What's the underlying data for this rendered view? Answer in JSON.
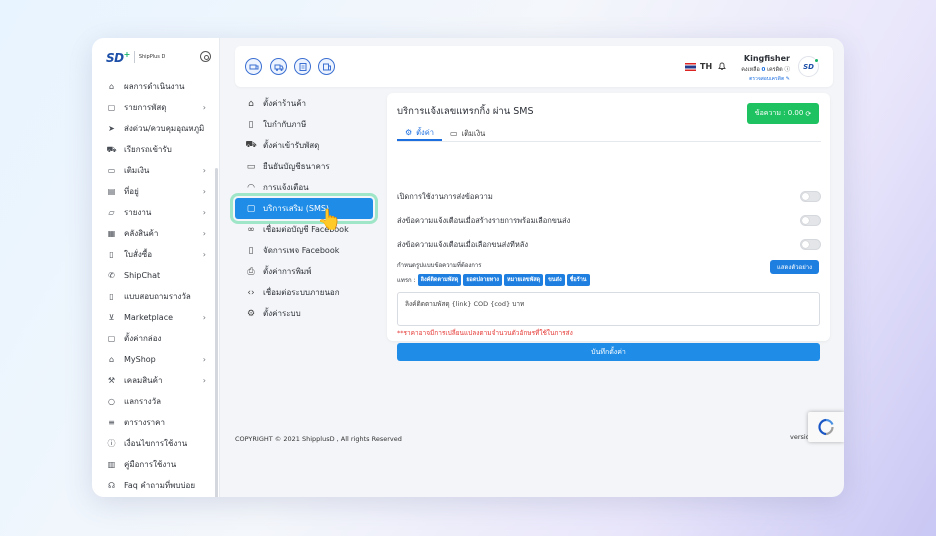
{
  "brand": {
    "logo": "SD",
    "logo_plus": "+",
    "sub": "ShipPlus D"
  },
  "sidebar": {
    "items": [
      {
        "label": "ผลการดำเนินงาน",
        "icon": "home-icon",
        "chevron": false
      },
      {
        "label": "รายการพัสดุ",
        "icon": "box-icon",
        "chevron": true
      },
      {
        "label": "ส่งด่วน/ควบคุมอุณหภูมิ",
        "icon": "fast-ship-icon",
        "chevron": false
      },
      {
        "label": "เรียกรถเข้ารับ",
        "icon": "truck-icon",
        "chevron": false
      },
      {
        "label": "เติมเงิน",
        "icon": "wallet-icon",
        "chevron": true
      },
      {
        "label": "ที่อยู่",
        "icon": "address-book-icon",
        "chevron": true
      },
      {
        "label": "รายงาน",
        "icon": "folder-icon",
        "chevron": true
      },
      {
        "label": "คลังสินค้า",
        "icon": "warehouse-icon",
        "chevron": true
      },
      {
        "label": "ใบสั่งซื้อ",
        "icon": "document-icon",
        "chevron": true
      },
      {
        "label": "ShipChat",
        "icon": "chat-icon",
        "chevron": false
      },
      {
        "label": "แบบสอบถามรางวัล",
        "icon": "document-icon",
        "chevron": false
      },
      {
        "label": "Marketplace",
        "icon": "cart-icon",
        "chevron": true
      },
      {
        "label": "ตั้งค่ากล่อง",
        "icon": "box-icon",
        "chevron": false
      },
      {
        "label": "MyShop",
        "icon": "shop-icon",
        "chevron": true
      },
      {
        "label": "เคลมสินค้า",
        "icon": "wrench-icon",
        "chevron": true
      },
      {
        "label": "แลกรางวัล",
        "icon": "reward-icon",
        "chevron": false
      },
      {
        "label": "ตารางราคา",
        "icon": "list-icon",
        "chevron": false
      },
      {
        "label": "เงื่อนไขการใช้งาน",
        "icon": "info-icon",
        "chevron": false
      },
      {
        "label": "คู่มือการใช้งาน",
        "icon": "book-icon",
        "chevron": false
      },
      {
        "label": "Faq คำถามที่พบบ่อย",
        "icon": "headset-icon",
        "chevron": false
      }
    ]
  },
  "header": {
    "lang": "TH",
    "user_name": "Kingfisher",
    "balance_label": "คงเหลือ",
    "balance_value": "0",
    "balance_unit": "เครดิต",
    "user_link": "ตรวจสอบเครดิต",
    "avatar_text": "SD"
  },
  "settings_menu": {
    "items": [
      {
        "label": "ตั้งค่าร้านค้า",
        "icon": "shop-icon"
      },
      {
        "label": "ใบกำกับภาษี",
        "icon": "document-icon"
      },
      {
        "label": "ตั้งค่าเข้ารับพัสดุ",
        "icon": "truck-icon"
      },
      {
        "label": "ยืนยันบัญชีธนาคาร",
        "icon": "card-icon"
      },
      {
        "label": "การแจ้งเตือน",
        "icon": "bell-icon"
      },
      {
        "label": "บริการเสริม (SMS)",
        "icon": "message-icon",
        "active": true
      },
      {
        "label": "เชื่อมต่อบัญชี Facebook",
        "icon": "link-icon"
      },
      {
        "label": "จัดการเพจ Facebook",
        "icon": "document-icon"
      },
      {
        "label": "ตั้งค่าการพิมพ์",
        "icon": "printer-icon"
      },
      {
        "label": "เชื่อมต่อระบบภายนอก",
        "icon": "code-icon"
      },
      {
        "label": "ตั้งค่าระบบ",
        "icon": "gear-icon"
      }
    ]
  },
  "sms": {
    "title": "บริการแจ้งเลขแทรกกิ้ง ผ่าน SMS",
    "credit_label": "ข้อความ : 0.00",
    "tabs": [
      {
        "label": "ตั้งค่า",
        "icon": "gear-icon",
        "active": true
      },
      {
        "label": "เติมเงิน",
        "icon": "card-icon",
        "active": false
      }
    ],
    "toggles": [
      {
        "label": "เปิดการใช้งานการส่งข้อความ"
      },
      {
        "label": "ส่งข้อความแจ้งเตือนเมื่อสร้างรายการพร้อมเลือกขนส่ง"
      },
      {
        "label": "ส่งข้อความแจ้งเตือนเมื่อเลือกขนส่งทีหลัง"
      }
    ],
    "template_label": "กำหนดรูปแบบข้อความที่ต้องการ",
    "sample_button": "แสดงตัวอย่าง",
    "insert_label": "แทรก :",
    "chips": [
      "ลิงค์ติดตามพัสดุ",
      "ยอดปลายทาง",
      "หมายเลขพัสดุ",
      "ขนส่ง",
      "ชื่อร้าน"
    ],
    "message_text": "ลิงค์ติดตามพัสดุ {link} COD {cod} บาท",
    "note": "**ราคาอาจมีการเปลี่ยนแปลงตามจำนวนตัวอักษรที่ใช้ในการส่ง",
    "save_button": "บันทึกตั้งค่า"
  },
  "footer": {
    "copyright": "COPYRIGHT © 2021 ShipplusD , All rights Reserved",
    "version": "versio"
  },
  "colors": {
    "primary": "#1f8de8",
    "success": "#1ec260",
    "danger": "#e53935",
    "brand": "#1d4fa8"
  }
}
